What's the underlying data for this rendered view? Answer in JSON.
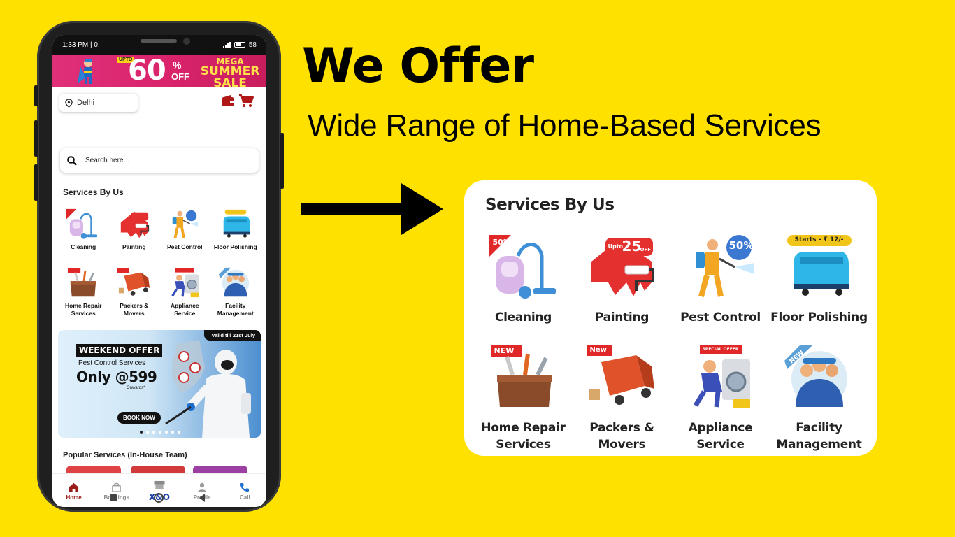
{
  "headline": "We Offer",
  "subheadline": "Wide Range of Home-Based Services",
  "phone": {
    "status": {
      "time": "1:33 PM | 0.",
      "battery": "58"
    },
    "promo": {
      "upto": "UPTO",
      "percent_num": "60",
      "percent_sign": "%",
      "off": "OFF",
      "line1": "MEGA",
      "line2": "SUMMER",
      "line3": "SALE"
    },
    "location": "Delhi",
    "search_placeholder": "Search here...",
    "section_title": "Services By Us",
    "services": [
      {
        "label": "Cleaning",
        "icon": "vacuum-icon"
      },
      {
        "label": "Painting",
        "icon": "paint-roller-icon"
      },
      {
        "label": "Pest Control",
        "icon": "sprayer-icon"
      },
      {
        "label": "Floor Polishing",
        "icon": "floor-scrubber-icon"
      },
      {
        "label": "Home Repair\nServices",
        "icon": "toolbox-icon"
      },
      {
        "label": "Packers &\nMovers",
        "icon": "truck-icon"
      },
      {
        "label": "Appliance\nService",
        "icon": "washing-machine-icon"
      },
      {
        "label": "Facility\nManagement",
        "icon": "team-icon"
      }
    ],
    "banner": {
      "valid": "Valid till 21st July",
      "title": "WEEKEND OFFER",
      "subtitle": "Pest Control Services",
      "price": "Only @599",
      "onwards": "Onwards*",
      "cta": "BOOK NOW"
    },
    "popular_title": "Popular Services (In-House Team)",
    "nav": [
      {
        "label": "Home",
        "icon": "home-icon"
      },
      {
        "label": "Bookings",
        "icon": "bag-icon"
      },
      {
        "label": "X&O",
        "icon": "store-icon"
      },
      {
        "label": "Profile",
        "icon": "person-icon"
      },
      {
        "label": "Call",
        "icon": "phone-icon"
      }
    ]
  },
  "card": {
    "title": "Services By Us",
    "services": [
      {
        "label": "Cleaning"
      },
      {
        "label": "Painting"
      },
      {
        "label": "Pest Control"
      },
      {
        "label": "Floor Polishing"
      },
      {
        "label": "Home Repair\nServices"
      },
      {
        "label": "Packers &\nMovers"
      },
      {
        "label": "Appliance\nService"
      },
      {
        "label": "Facility\nManagement"
      }
    ],
    "badges": {
      "fifty": "50%",
      "upto": "Upto",
      "twentyfive": "25",
      "off": "OFF",
      "starts": "Starts - ₹ 12/-",
      "new": "NEW",
      "new2": "New",
      "special": "SPECIAL OFFER"
    }
  },
  "colors": {
    "background": "#FFE100",
    "brand_red": "#d21d2a",
    "promo_pink": "#d9236b",
    "nav_active": "#9a1b1b"
  }
}
